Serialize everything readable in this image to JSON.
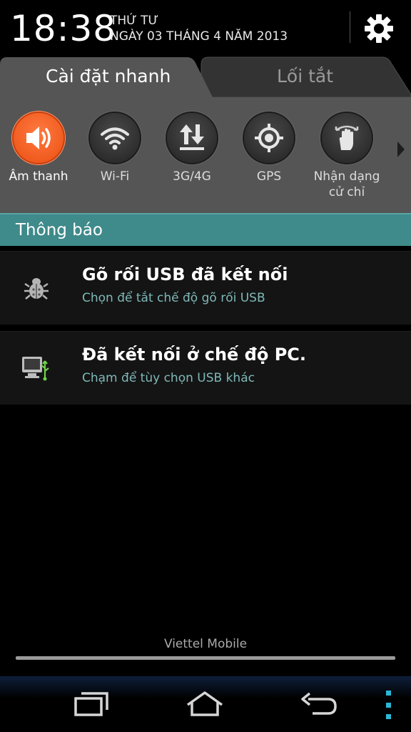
{
  "status": {
    "time": "18:38",
    "weekday": "THỨ TƯ",
    "date": "NGÀY 03 THÁNG 4 NĂM 2013",
    "settings_icon": "gear-icon"
  },
  "tabs": [
    {
      "label": "Cài đặt nhanh",
      "active": true
    },
    {
      "label": "Lối tắt",
      "active": false
    }
  ],
  "quick_settings": [
    {
      "label": "Âm thanh",
      "icon": "speaker-icon",
      "on": true
    },
    {
      "label": "Wi-Fi",
      "icon": "wifi-icon",
      "on": false
    },
    {
      "label": "3G/4G",
      "icon": "data-arrows-icon",
      "on": false
    },
    {
      "label": "GPS",
      "icon": "gps-icon",
      "on": false
    },
    {
      "label": "Nhận dạng cử chỉ",
      "icon": "gesture-hand-icon",
      "on": false
    }
  ],
  "notifications_header": "Thông báo",
  "notifications": [
    {
      "title": "Gõ rối USB đã kết nối",
      "subtitle": "Chọn để tắt chế độ gõ rối USB",
      "icon": "bug-icon"
    },
    {
      "title": "Đã kết nối ở chế độ PC.",
      "subtitle": "Chạm để tùy chọn USB khác",
      "icon": "usb-pc-icon"
    }
  ],
  "carrier": "Viettel Mobile",
  "colors": {
    "accent_on": "#f05a1e",
    "notif_header": "#3f8a8a",
    "notif_sub": "#7fb8b8",
    "nav_menu": "#2bb8d6"
  }
}
